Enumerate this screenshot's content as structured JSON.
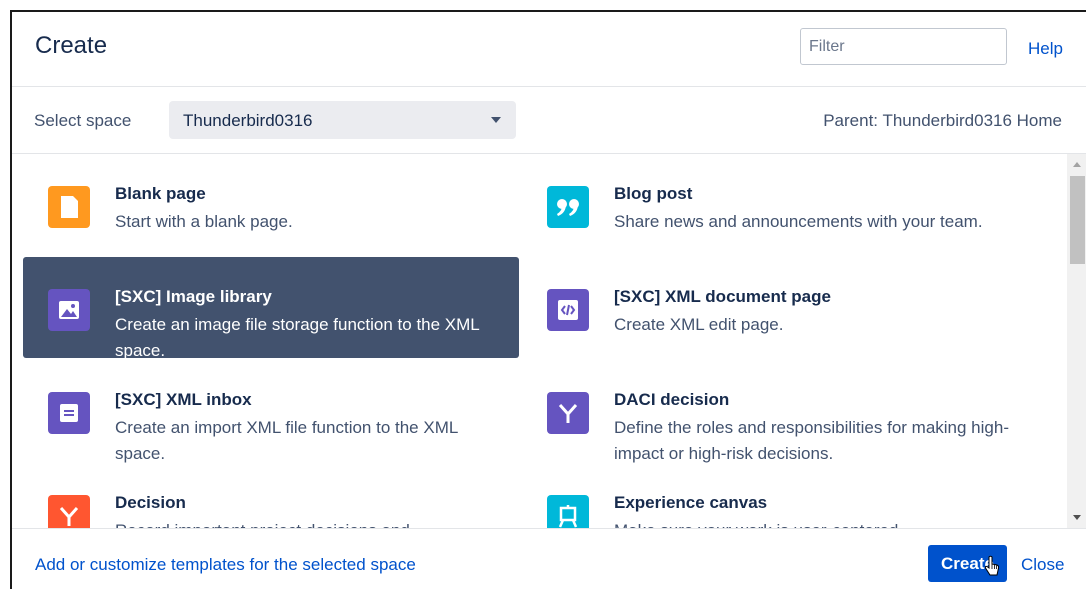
{
  "dialog": {
    "title": "Create",
    "help_label": "Help"
  },
  "filter": {
    "placeholder": "Filter",
    "value": ""
  },
  "space": {
    "label": "Select space",
    "selected": "Thunderbird0316",
    "parent": "Parent: Thunderbird0316 Home"
  },
  "templates": [
    {
      "name": "Blank page",
      "description": "Start with a blank page.",
      "icon": "blank-page-icon",
      "color": "#ff991f",
      "selected": false
    },
    {
      "name": "Blog post",
      "description": "Share news and announcements with your team.",
      "icon": "quote-icon",
      "color": "#00b8d9",
      "selected": false
    },
    {
      "name": "[SXC] Image library",
      "description": "Create an image file storage function to the XML space.",
      "icon": "image-icon",
      "color": "#6554c0",
      "selected": true
    },
    {
      "name": "[SXC] XML document page",
      "description": "Create XML edit page.",
      "icon": "code-icon",
      "color": "#6554c0",
      "selected": false
    },
    {
      "name": "[SXC] XML inbox",
      "description": "Create an import XML file function to the XML space.",
      "icon": "inbox-icon",
      "color": "#6554c0",
      "selected": false
    },
    {
      "name": "DACI decision",
      "description": "Define the roles and responsibilities for making high-impact or high-risk decisions.",
      "icon": "decision-fork-icon",
      "color": "#6554c0",
      "selected": false
    },
    {
      "name": "Decision",
      "description": "Record important project decisions and",
      "icon": "decision-fork-icon",
      "color": "#ff5630",
      "selected": false
    },
    {
      "name": "Experience canvas",
      "description": "Make sure your work is user-centered",
      "icon": "canvas-icon",
      "color": "#00b8d9",
      "selected": false
    }
  ],
  "footer": {
    "customize_link": "Add or customize templates for the selected space",
    "create_label": "Create",
    "close_label": "Close"
  },
  "colors": {
    "accent": "#0052cc",
    "selected_bg": "#42526e"
  }
}
